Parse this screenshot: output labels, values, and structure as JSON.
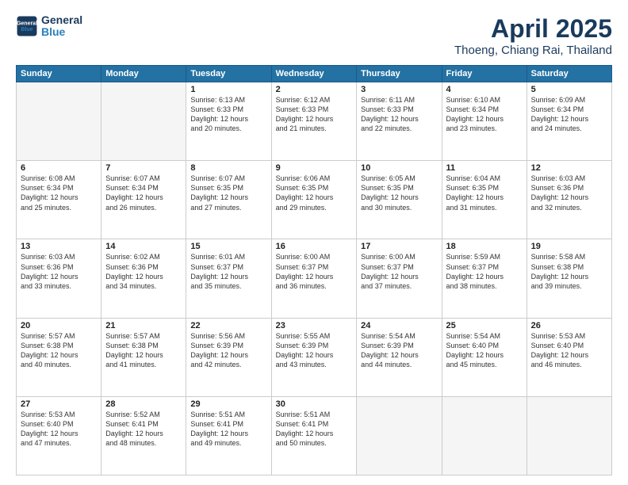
{
  "logo": {
    "line1": "General",
    "line2": "Blue"
  },
  "title": "April 2025",
  "subtitle": "Thoeng, Chiang Rai, Thailand",
  "days_header": [
    "Sunday",
    "Monday",
    "Tuesday",
    "Wednesday",
    "Thursday",
    "Friday",
    "Saturday"
  ],
  "weeks": [
    [
      {
        "day": "",
        "info": ""
      },
      {
        "day": "",
        "info": ""
      },
      {
        "day": "1",
        "info": "Sunrise: 6:13 AM\nSunset: 6:33 PM\nDaylight: 12 hours\nand 20 minutes."
      },
      {
        "day": "2",
        "info": "Sunrise: 6:12 AM\nSunset: 6:33 PM\nDaylight: 12 hours\nand 21 minutes."
      },
      {
        "day": "3",
        "info": "Sunrise: 6:11 AM\nSunset: 6:33 PM\nDaylight: 12 hours\nand 22 minutes."
      },
      {
        "day": "4",
        "info": "Sunrise: 6:10 AM\nSunset: 6:34 PM\nDaylight: 12 hours\nand 23 minutes."
      },
      {
        "day": "5",
        "info": "Sunrise: 6:09 AM\nSunset: 6:34 PM\nDaylight: 12 hours\nand 24 minutes."
      }
    ],
    [
      {
        "day": "6",
        "info": "Sunrise: 6:08 AM\nSunset: 6:34 PM\nDaylight: 12 hours\nand 25 minutes."
      },
      {
        "day": "7",
        "info": "Sunrise: 6:07 AM\nSunset: 6:34 PM\nDaylight: 12 hours\nand 26 minutes."
      },
      {
        "day": "8",
        "info": "Sunrise: 6:07 AM\nSunset: 6:35 PM\nDaylight: 12 hours\nand 27 minutes."
      },
      {
        "day": "9",
        "info": "Sunrise: 6:06 AM\nSunset: 6:35 PM\nDaylight: 12 hours\nand 29 minutes."
      },
      {
        "day": "10",
        "info": "Sunrise: 6:05 AM\nSunset: 6:35 PM\nDaylight: 12 hours\nand 30 minutes."
      },
      {
        "day": "11",
        "info": "Sunrise: 6:04 AM\nSunset: 6:35 PM\nDaylight: 12 hours\nand 31 minutes."
      },
      {
        "day": "12",
        "info": "Sunrise: 6:03 AM\nSunset: 6:36 PM\nDaylight: 12 hours\nand 32 minutes."
      }
    ],
    [
      {
        "day": "13",
        "info": "Sunrise: 6:03 AM\nSunset: 6:36 PM\nDaylight: 12 hours\nand 33 minutes."
      },
      {
        "day": "14",
        "info": "Sunrise: 6:02 AM\nSunset: 6:36 PM\nDaylight: 12 hours\nand 34 minutes."
      },
      {
        "day": "15",
        "info": "Sunrise: 6:01 AM\nSunset: 6:37 PM\nDaylight: 12 hours\nand 35 minutes."
      },
      {
        "day": "16",
        "info": "Sunrise: 6:00 AM\nSunset: 6:37 PM\nDaylight: 12 hours\nand 36 minutes."
      },
      {
        "day": "17",
        "info": "Sunrise: 6:00 AM\nSunset: 6:37 PM\nDaylight: 12 hours\nand 37 minutes."
      },
      {
        "day": "18",
        "info": "Sunrise: 5:59 AM\nSunset: 6:37 PM\nDaylight: 12 hours\nand 38 minutes."
      },
      {
        "day": "19",
        "info": "Sunrise: 5:58 AM\nSunset: 6:38 PM\nDaylight: 12 hours\nand 39 minutes."
      }
    ],
    [
      {
        "day": "20",
        "info": "Sunrise: 5:57 AM\nSunset: 6:38 PM\nDaylight: 12 hours\nand 40 minutes."
      },
      {
        "day": "21",
        "info": "Sunrise: 5:57 AM\nSunset: 6:38 PM\nDaylight: 12 hours\nand 41 minutes."
      },
      {
        "day": "22",
        "info": "Sunrise: 5:56 AM\nSunset: 6:39 PM\nDaylight: 12 hours\nand 42 minutes."
      },
      {
        "day": "23",
        "info": "Sunrise: 5:55 AM\nSunset: 6:39 PM\nDaylight: 12 hours\nand 43 minutes."
      },
      {
        "day": "24",
        "info": "Sunrise: 5:54 AM\nSunset: 6:39 PM\nDaylight: 12 hours\nand 44 minutes."
      },
      {
        "day": "25",
        "info": "Sunrise: 5:54 AM\nSunset: 6:40 PM\nDaylight: 12 hours\nand 45 minutes."
      },
      {
        "day": "26",
        "info": "Sunrise: 5:53 AM\nSunset: 6:40 PM\nDaylight: 12 hours\nand 46 minutes."
      }
    ],
    [
      {
        "day": "27",
        "info": "Sunrise: 5:53 AM\nSunset: 6:40 PM\nDaylight: 12 hours\nand 47 minutes."
      },
      {
        "day": "28",
        "info": "Sunrise: 5:52 AM\nSunset: 6:41 PM\nDaylight: 12 hours\nand 48 minutes."
      },
      {
        "day": "29",
        "info": "Sunrise: 5:51 AM\nSunset: 6:41 PM\nDaylight: 12 hours\nand 49 minutes."
      },
      {
        "day": "30",
        "info": "Sunrise: 5:51 AM\nSunset: 6:41 PM\nDaylight: 12 hours\nand 50 minutes."
      },
      {
        "day": "",
        "info": ""
      },
      {
        "day": "",
        "info": ""
      },
      {
        "day": "",
        "info": ""
      }
    ]
  ]
}
